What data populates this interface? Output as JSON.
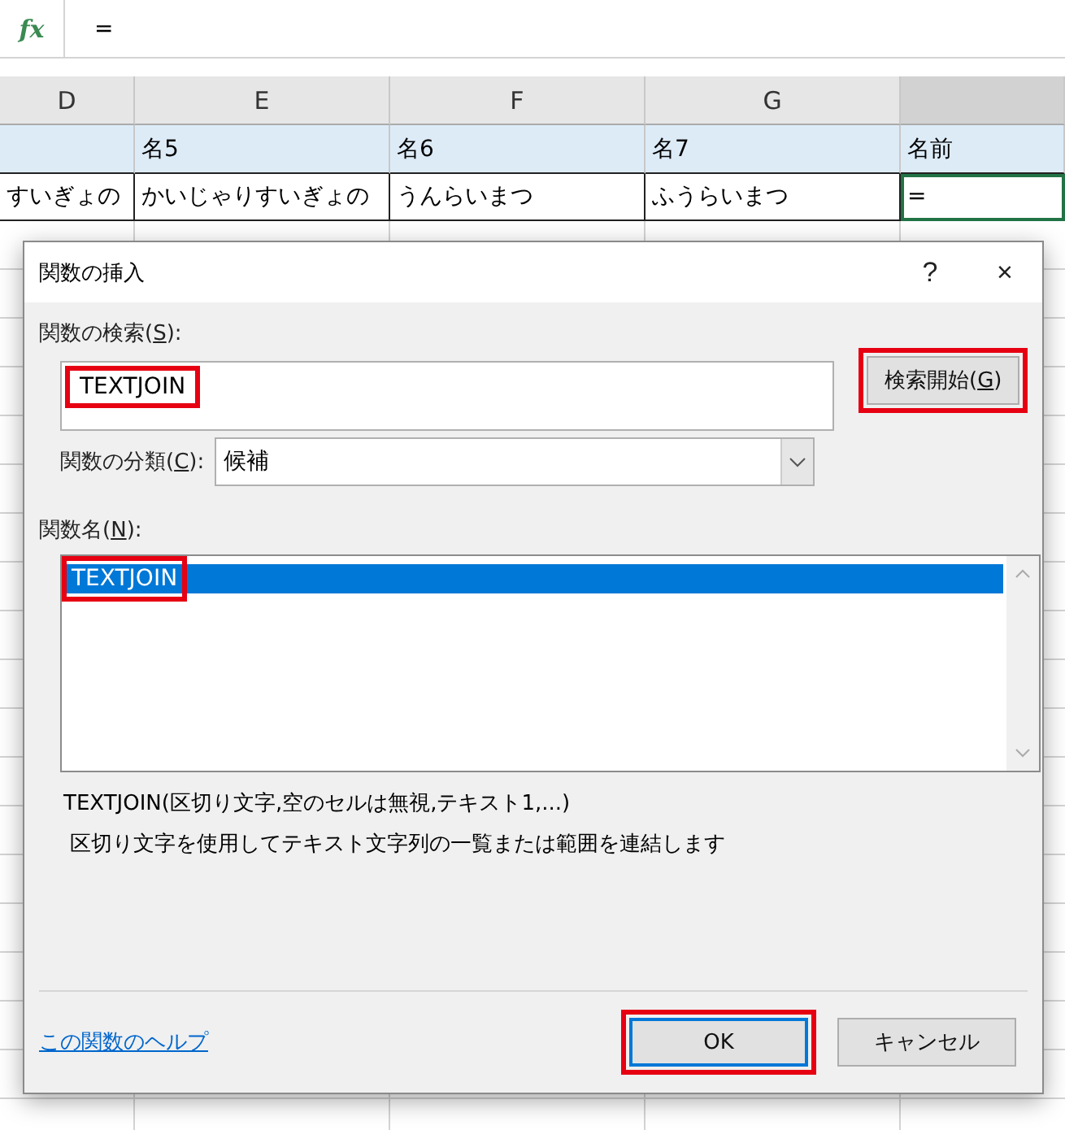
{
  "formula_bar": {
    "fx_label": "fx",
    "value": "="
  },
  "columns": [
    {
      "label": "D",
      "selected": false
    },
    {
      "label": "E",
      "selected": false
    },
    {
      "label": "F",
      "selected": false
    },
    {
      "label": "G",
      "selected": false
    },
    {
      "selected": true
    }
  ],
  "rows": [
    {
      "kind": "header",
      "cells": [
        {
          "text": "",
          "active": false
        },
        {
          "text": "名5",
          "active": false
        },
        {
          "text": "名6",
          "active": false
        },
        {
          "text": "名7",
          "active": false
        },
        {
          "text": "名前",
          "active": false
        }
      ]
    },
    {
      "kind": "data",
      "cells": [
        {
          "text": "すいぎょの",
          "active": false
        },
        {
          "text": "かいじゃりすいぎょの",
          "active": false
        },
        {
          "text": "うんらいまつ",
          "active": false
        },
        {
          "text": "ふうらいまつ",
          "active": false
        },
        {
          "text": "=",
          "active": true
        }
      ]
    }
  ],
  "dialog": {
    "title": "関数の挿入",
    "help": "?",
    "close": "×",
    "search_label": {
      "before": "関数の検索(",
      "key": "S",
      "after": "):"
    },
    "search_value": "TEXTJOIN",
    "search_highlighted": true,
    "search_button": {
      "before": "検索開始(",
      "key": "G",
      "after": ")",
      "highlighted": true
    },
    "category_label": {
      "before": "関数の分類(",
      "key": "C",
      "after": "):"
    },
    "category_value": "候補",
    "list_label": {
      "before": "関数名(",
      "key": "N",
      "after": "):"
    },
    "functions": [
      {
        "name": "TEXTJOIN",
        "selected": true,
        "highlighted": true
      }
    ],
    "signature": "TEXTJOIN(区切り文字,空のセルは無視,テキスト1,...)",
    "description": "区切り文字を使用してテキスト文字列の一覧または範囲を連結します",
    "help_link": "この関数のヘルプ",
    "buttons": [
      {
        "label": "OK",
        "focused": true,
        "highlighted": true
      },
      {
        "label": "キャンセル",
        "focused": false,
        "highlighted": false
      }
    ]
  }
}
